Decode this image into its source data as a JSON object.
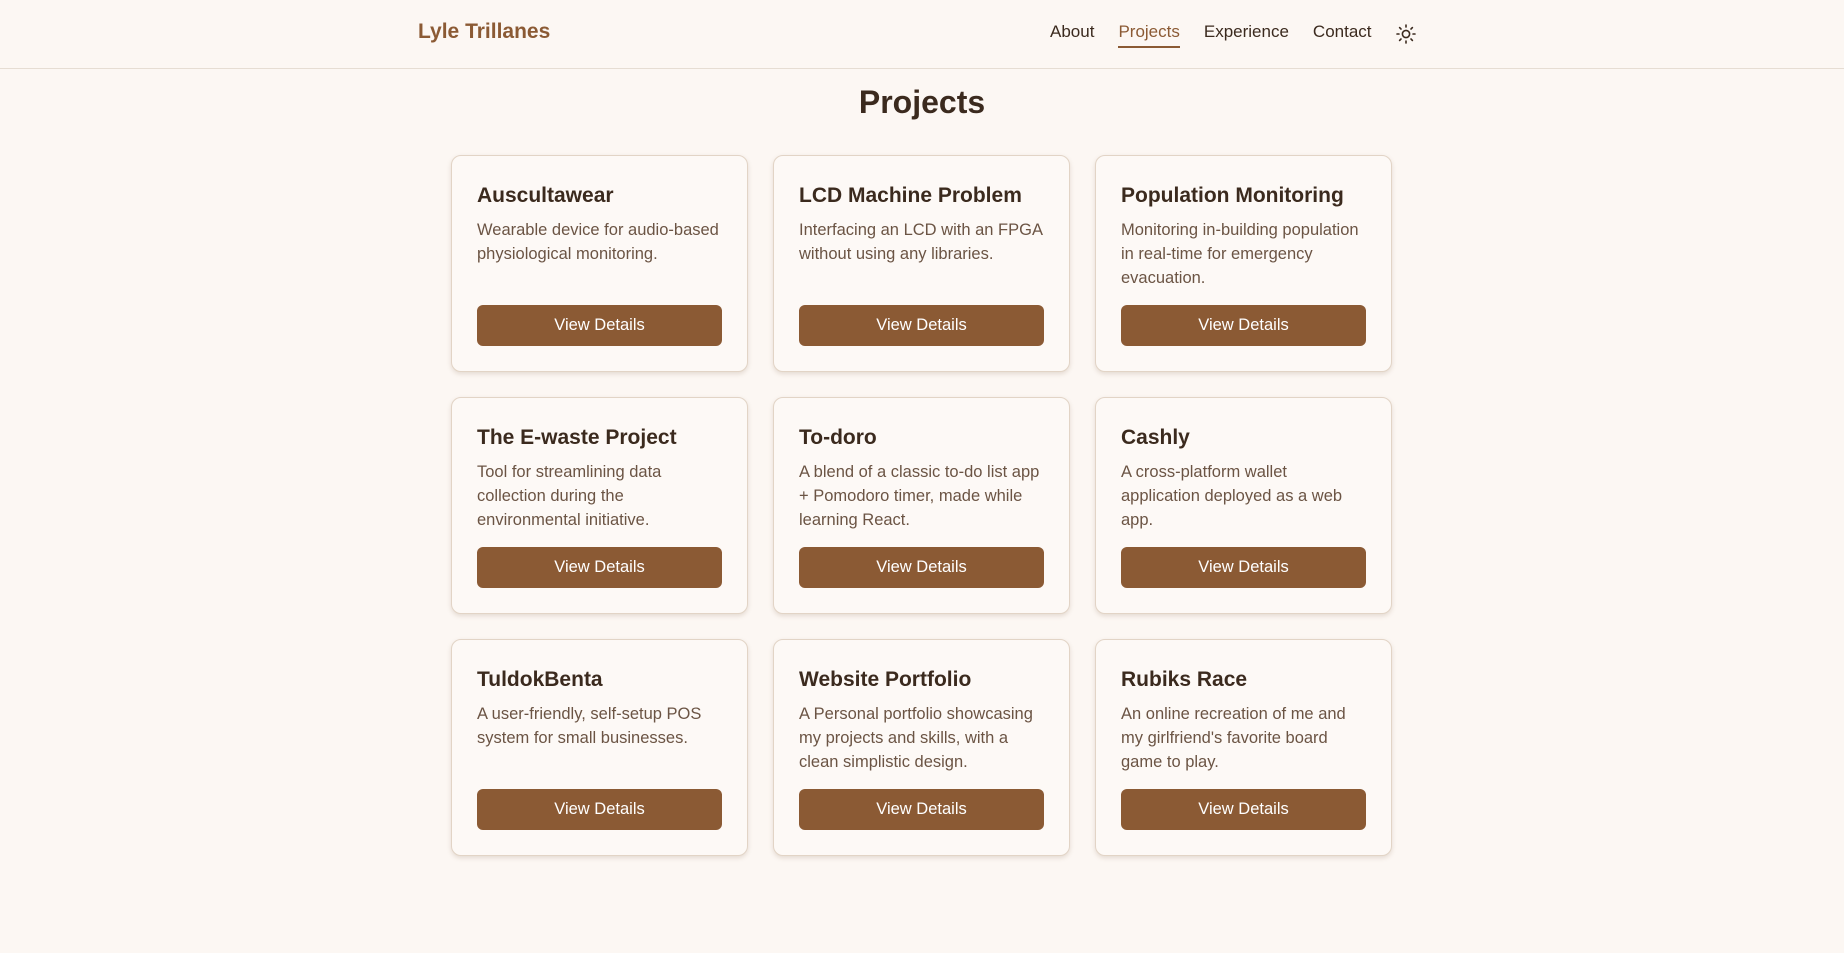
{
  "header": {
    "brand": "Lyle Trillanes",
    "nav": [
      {
        "label": "About",
        "active": false
      },
      {
        "label": "Projects",
        "active": true
      },
      {
        "label": "Experience",
        "active": false
      },
      {
        "label": "Contact",
        "active": false
      }
    ],
    "theme_toggle_icon": "sun-icon"
  },
  "main": {
    "title": "Projects",
    "projects": [
      {
        "title": "Auscultawear",
        "description": "Wearable device for audio-based physiological monitoring.",
        "button": "View Details"
      },
      {
        "title": "LCD Machine Problem",
        "description": "Interfacing an LCD with an FPGA without using any libraries.",
        "button": "View Details"
      },
      {
        "title": "Population Monitoring",
        "description": "Monitoring in-building population in real-time for emergency evacuation.",
        "button": "View Details"
      },
      {
        "title": "The E-waste Project",
        "description": "Tool for streamlining data collection during the environmental initiative.",
        "button": "View Details"
      },
      {
        "title": "To-doro",
        "description": "A blend of a classic to-do list app + Pomodoro timer, made while learning React.",
        "button": "View Details"
      },
      {
        "title": "Cashly",
        "description": "A cross-platform wallet application deployed as a web app.",
        "button": "View Details"
      },
      {
        "title": "TuldokBenta",
        "description": "A user-friendly, self-setup POS system for small businesses.",
        "button": "View Details"
      },
      {
        "title": "Website Portfolio",
        "description": "A Personal portfolio showcasing my projects and skills, with a clean simplistic design.",
        "button": "View Details"
      },
      {
        "title": "Rubiks Race",
        "description": "An online recreation of me and my girlfriend's favorite board game to play.",
        "button": "View Details"
      }
    ]
  },
  "colors": {
    "background": "#fcf7f3",
    "accent": "#8b5a34",
    "text": "#3b2a1e",
    "muted_text": "#6b5444"
  }
}
